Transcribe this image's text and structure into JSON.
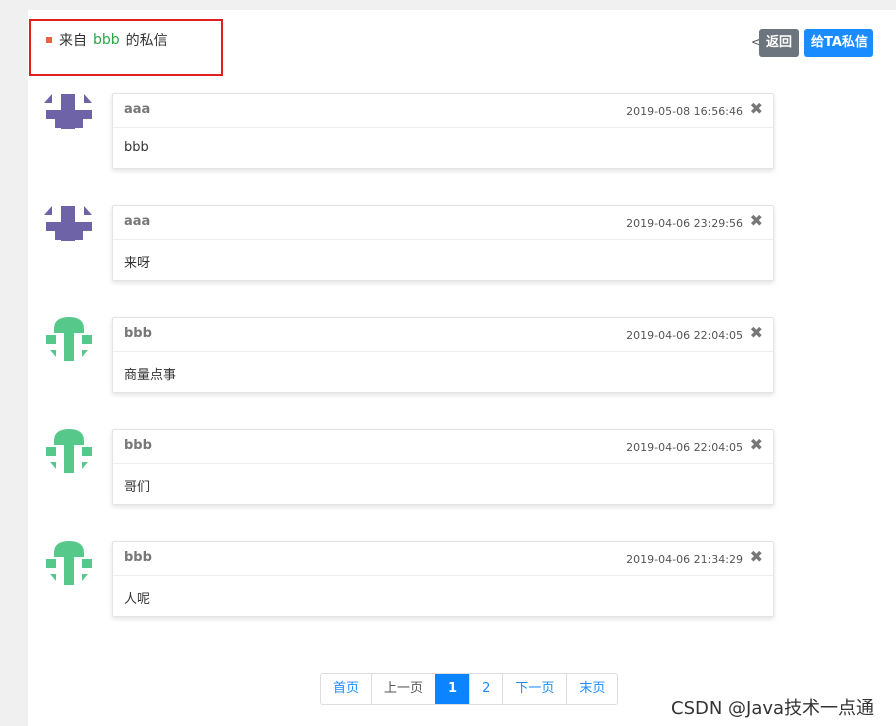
{
  "header": {
    "title_prefix": "来自",
    "title_user": "bbb",
    "title_suffix": "的私信",
    "lt_char": "<",
    "back_label": "返回",
    "dm_label": "给TA私信",
    "accent_bullet_color": "#e8643c",
    "user_color": "#28a745"
  },
  "messages": [
    {
      "sender": "aaa",
      "time": "2019-05-08 16:56:46",
      "content": "bbb",
      "avatar": "purple-pixel-avatar",
      "close": "✖"
    },
    {
      "sender": "aaa",
      "time": "2019-04-06 23:29:56",
      "content": "来呀",
      "avatar": "purple-pixel-avatar",
      "close": "✖"
    },
    {
      "sender": "bbb",
      "time": "2019-04-06 22:04:05",
      "content": "商量点事",
      "avatar": "green-pixel-avatar",
      "close": "✖"
    },
    {
      "sender": "bbb",
      "time": "2019-04-06 22:04:05",
      "content": "哥们",
      "avatar": "green-pixel-avatar",
      "close": "✖"
    },
    {
      "sender": "bbb",
      "time": "2019-04-06 21:34:29",
      "content": "人呢",
      "avatar": "green-pixel-avatar",
      "close": "✖"
    }
  ],
  "pagination": {
    "first": "首页",
    "prev": "上一页",
    "pages": [
      "1",
      "2"
    ],
    "current": "1",
    "next": "下一页",
    "last": "末页"
  },
  "watermark": "CSDN @Java技术一点通",
  "colors": {
    "purple_avatar": "#6f63a8",
    "green_avatar": "#55c88a",
    "primary": "#1a8cff",
    "secondary": "#6c757d"
  }
}
